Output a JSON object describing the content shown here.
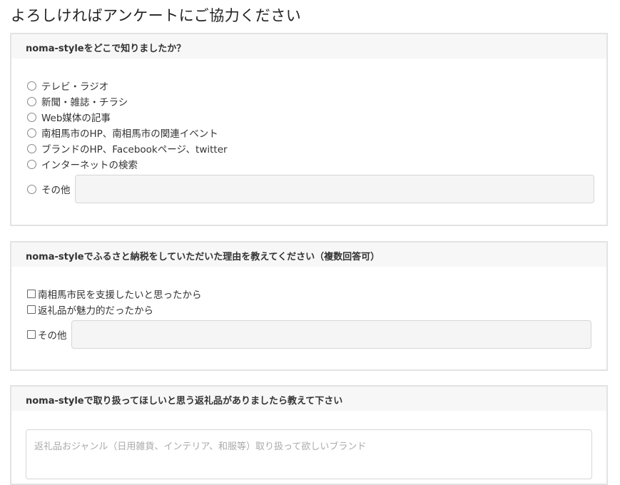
{
  "title": "よろしければアンケートにご協力ください",
  "q1": {
    "heading": "noma-styleをどこで知りましたか？",
    "options": [
      "テレビ・ラジオ",
      "新聞・雑誌・チラシ",
      "Web媒体の記事",
      "南相馬市のHP、南相馬市の関連イベント",
      "ブランドのHP、Facebookページ、twitter",
      "インターネットの検索"
    ],
    "other_label": "その他",
    "other_value": ""
  },
  "q2": {
    "heading": "noma-styleでふるさと納税をしていただいた理由を教えてください（複数回答可）",
    "options": [
      "南相馬市民を支援したいと思ったから",
      "返礼品が魅力的だったから"
    ],
    "other_label": "その他",
    "other_value": ""
  },
  "q3": {
    "heading": "noma-styleで取り扱ってほしいと思う返礼品がありましたら教えて下さい",
    "placeholder": "返礼品おジャンル（日用雑貨、インテリア、和服等）取り扱って欲しいブランド"
  }
}
